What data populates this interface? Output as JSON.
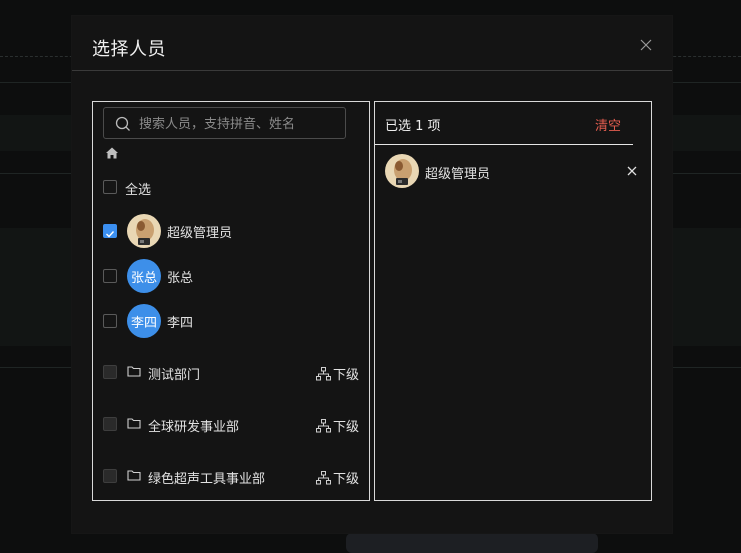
{
  "modal": {
    "title": "选择人员"
  },
  "search": {
    "placeholder": "搜索人员，支持拼音、姓名"
  },
  "select_all": {
    "label": "全选"
  },
  "people": [
    {
      "name": "超级管理员",
      "checked": true,
      "avatar": "photo"
    },
    {
      "name": "张总",
      "checked": false,
      "avatar_text": "张总"
    },
    {
      "name": "李四",
      "checked": false,
      "avatar_text": "李四"
    }
  ],
  "departments": [
    {
      "name": "测试部门",
      "sub_label": "下级"
    },
    {
      "name": "全球研发事业部",
      "sub_label": "下级"
    },
    {
      "name": "绿色超声工具事业部",
      "sub_label": "下级"
    }
  ],
  "selected": {
    "count_text": "已选 1 项",
    "clear_label": "清空",
    "items": [
      {
        "name": "超级管理员"
      }
    ]
  },
  "colors": {
    "accent": "#3b8ff0",
    "avatar_bg": "#3d8fe9",
    "danger": "#e35d4f",
    "modal_bg": "#141414"
  },
  "icons": [
    "search-icon",
    "home-icon",
    "folder-icon",
    "org-tree-icon",
    "close-icon",
    "check-icon"
  ]
}
